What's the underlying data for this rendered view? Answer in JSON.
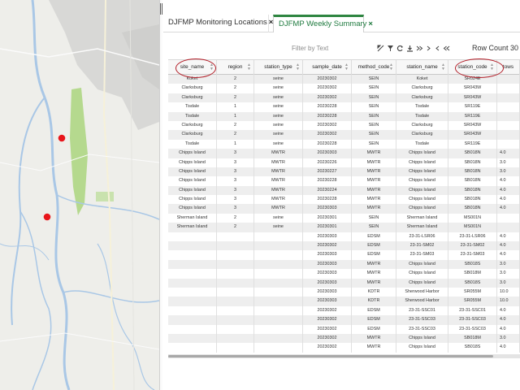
{
  "tabs": [
    {
      "label": "DJFMP Monitoring Locations",
      "close": "×"
    },
    {
      "label": "DJFMP Weekly Summary",
      "close": "×"
    }
  ],
  "toolbar": {
    "filter_placeholder": "Filter by Text",
    "row_count_label": "Row Count  30",
    "icons": [
      "toggle-filter-icon",
      "filter-icon",
      "refresh-icon",
      "download-icon",
      "last-page-icon",
      "next-page-icon",
      "prev-page-icon",
      "first-page-icon"
    ]
  },
  "table": {
    "columns": [
      "site_name",
      "region",
      "station_type",
      "sample_date",
      "method_code",
      "station_name",
      "station_code",
      "tows"
    ],
    "rows": [
      [
        "Koket",
        "2",
        "seine",
        "20230302",
        "SEIN",
        "Koket",
        "SR024E",
        ""
      ],
      [
        "Clarksburg",
        "2",
        "seine",
        "20230302",
        "SEIN",
        "Clarksburg",
        "SR043W",
        ""
      ],
      [
        "Clarksburg",
        "2",
        "seine",
        "20230302",
        "SEIN",
        "Clarksburg",
        "SR043W",
        ""
      ],
      [
        "Tisdale",
        "1",
        "seine",
        "20230228",
        "SEIN",
        "Tisdale",
        "SR119E",
        ""
      ],
      [
        "Tisdale",
        "1",
        "seine",
        "20230228",
        "SEIN",
        "Tisdale",
        "SR119E",
        ""
      ],
      [
        "Clarksburg",
        "2",
        "seine",
        "20230302",
        "SEIN",
        "Clarksburg",
        "SR043W",
        ""
      ],
      [
        "Clarksburg",
        "2",
        "seine",
        "20230302",
        "SEIN",
        "Clarksburg",
        "SR043W",
        ""
      ],
      [
        "Tisdale",
        "1",
        "seine",
        "20230228",
        "SEIN",
        "Tisdale",
        "SR119E",
        ""
      ],
      [
        "Chipps Island",
        "3",
        "MWTR",
        "20230303",
        "MWTR",
        "Chipps Island",
        "SB018N",
        "4.0"
      ],
      [
        "Chipps Island",
        "3",
        "MWTR",
        "20230226",
        "MWTR",
        "Chipps Island",
        "SB018N",
        "3.0"
      ],
      [
        "Chipps Island",
        "3",
        "MWTR",
        "20230227",
        "MWTR",
        "Chipps Island",
        "SB018N",
        "3.0"
      ],
      [
        "Chipps Island",
        "3",
        "MWTR",
        "20230228",
        "MWTR",
        "Chipps Island",
        "SB018N",
        "4.0"
      ],
      [
        "Chipps Island",
        "3",
        "MWTR",
        "20230224",
        "MWTR",
        "Chipps Island",
        "SB018N",
        "4.0"
      ],
      [
        "Chipps Island",
        "3",
        "MWTR",
        "20230228",
        "MWTR",
        "Chipps Island",
        "SB018N",
        "4.0"
      ],
      [
        "Chipps Island",
        "3",
        "MWTR",
        "20230303",
        "MWTR",
        "Chipps Island",
        "SB018N",
        "4.0"
      ],
      [
        "Sherman Island",
        "2",
        "seine",
        "20230301",
        "SEIN",
        "Sherman Island",
        "MS001N",
        ""
      ],
      [
        "Sherman Island",
        "2",
        "seine",
        "20230301",
        "SEIN",
        "Sherman Island",
        "MS001N",
        ""
      ],
      [
        "",
        "",
        "",
        "20230303",
        "EDSM",
        "23-31-LSR06",
        "23-31-LSR06",
        "4.0"
      ],
      [
        "",
        "",
        "",
        "20230302",
        "EDSM",
        "23-31-SM02",
        "23-31-SM02",
        "4.0"
      ],
      [
        "",
        "",
        "",
        "20230303",
        "EDSM",
        "23-31-SM03",
        "23-31-SM03",
        "4.0"
      ],
      [
        "",
        "",
        "",
        "20230303",
        "MWTR",
        "Chipps Island",
        "SB018S",
        "3.0"
      ],
      [
        "",
        "",
        "",
        "20230303",
        "MWTR",
        "Chipps Island",
        "SB018M",
        "3.0"
      ],
      [
        "",
        "",
        "",
        "20230303",
        "MWTR",
        "Chipps Island",
        "SB018S",
        "3.0"
      ],
      [
        "",
        "",
        "",
        "20230303",
        "KDTR",
        "Sherwood Harbor",
        "SR055M",
        "10.0"
      ],
      [
        "",
        "",
        "",
        "20230303",
        "KDTR",
        "Sherwood Harbor",
        "SR055M",
        "10.0"
      ],
      [
        "",
        "",
        "",
        "20230302",
        "EDSM",
        "23-31-SSC01",
        "23-31-SSC01",
        "4.0"
      ],
      [
        "",
        "",
        "",
        "20230302",
        "EDSM",
        "23-31-SSC03",
        "23-31-SSC03",
        "4.0"
      ],
      [
        "",
        "",
        "",
        "20230302",
        "EDSM",
        "23-31-SSC03",
        "23-31-SSC03",
        "4.0"
      ],
      [
        "",
        "",
        "",
        "20230302",
        "MWTR",
        "Chipps Island",
        "SB018M",
        "3.0"
      ],
      [
        "",
        "",
        "",
        "20230302",
        "MWTR",
        "Chipps Island",
        "SB018S",
        "4.0"
      ]
    ]
  },
  "map": {
    "markers": [
      "sample-site",
      "sample-site"
    ],
    "marker_color": "#e8151b",
    "green_area_color": "#b5d98e",
    "river_color": "#a9c7e6"
  },
  "colors": {
    "accent": "#2e8540",
    "annotation": "#b3202a"
  }
}
